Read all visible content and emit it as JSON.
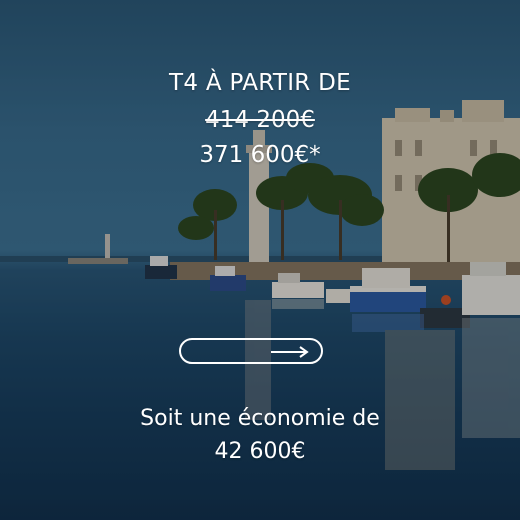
{
  "ad": {
    "headline": "T4 À PARTIR DE",
    "old_price": "414 200€",
    "new_price": "371 600€*",
    "savings_line": "Soit une économie de",
    "savings_amount": "42 600€"
  },
  "cta": {
    "icon": "arrow-right-icon"
  },
  "colors": {
    "text": "#ffffff",
    "water": "#1f4b6d",
    "sky": "#3a6f92"
  }
}
